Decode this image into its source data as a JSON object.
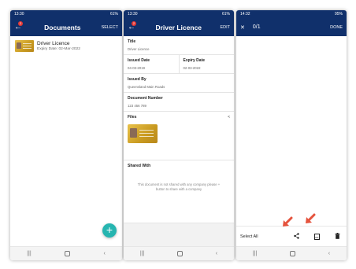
{
  "screens": [
    {
      "status_time": "13:30",
      "status_right": "61%",
      "badge": "2",
      "title": "Documents",
      "action": "SELECT",
      "item_name": "Driver Licence",
      "item_sub": "Expiry Date: 02-Mar-2022",
      "fab_label": "+"
    },
    {
      "status_time": "13:30",
      "status_right": "61%",
      "badge": "2",
      "title": "Driver Licence",
      "action": "EDIT",
      "title_label": "Title",
      "title_value": "Driver Licence",
      "issued_label": "Issued Date",
      "issued_value": "04-03-2019",
      "expiry_label": "Expiry Date",
      "expiry_value": "02-03-2022",
      "issued_by_label": "Issued By",
      "issued_by_value": "Queensland Main Roads",
      "docnum_label": "Document Number",
      "docnum_value": "123 456 789",
      "files_label": "Files",
      "shared_label": "Shared With",
      "shared_note": "This document is not shared with any company please + button to share with a company"
    },
    {
      "status_time": "14:32",
      "status_right": "95%",
      "counter": "0/1",
      "action": "DONE",
      "select_all": "Select All",
      "pdf_label": "PDF"
    }
  ],
  "colors": {
    "appbar": "#10306b",
    "fab": "#26b5b0",
    "arrow": "#e5533d"
  },
  "icons": [
    "back-arrow-icon",
    "add-icon",
    "share-icon",
    "pdf-download-icon",
    "trash-icon",
    "close-icon"
  ]
}
